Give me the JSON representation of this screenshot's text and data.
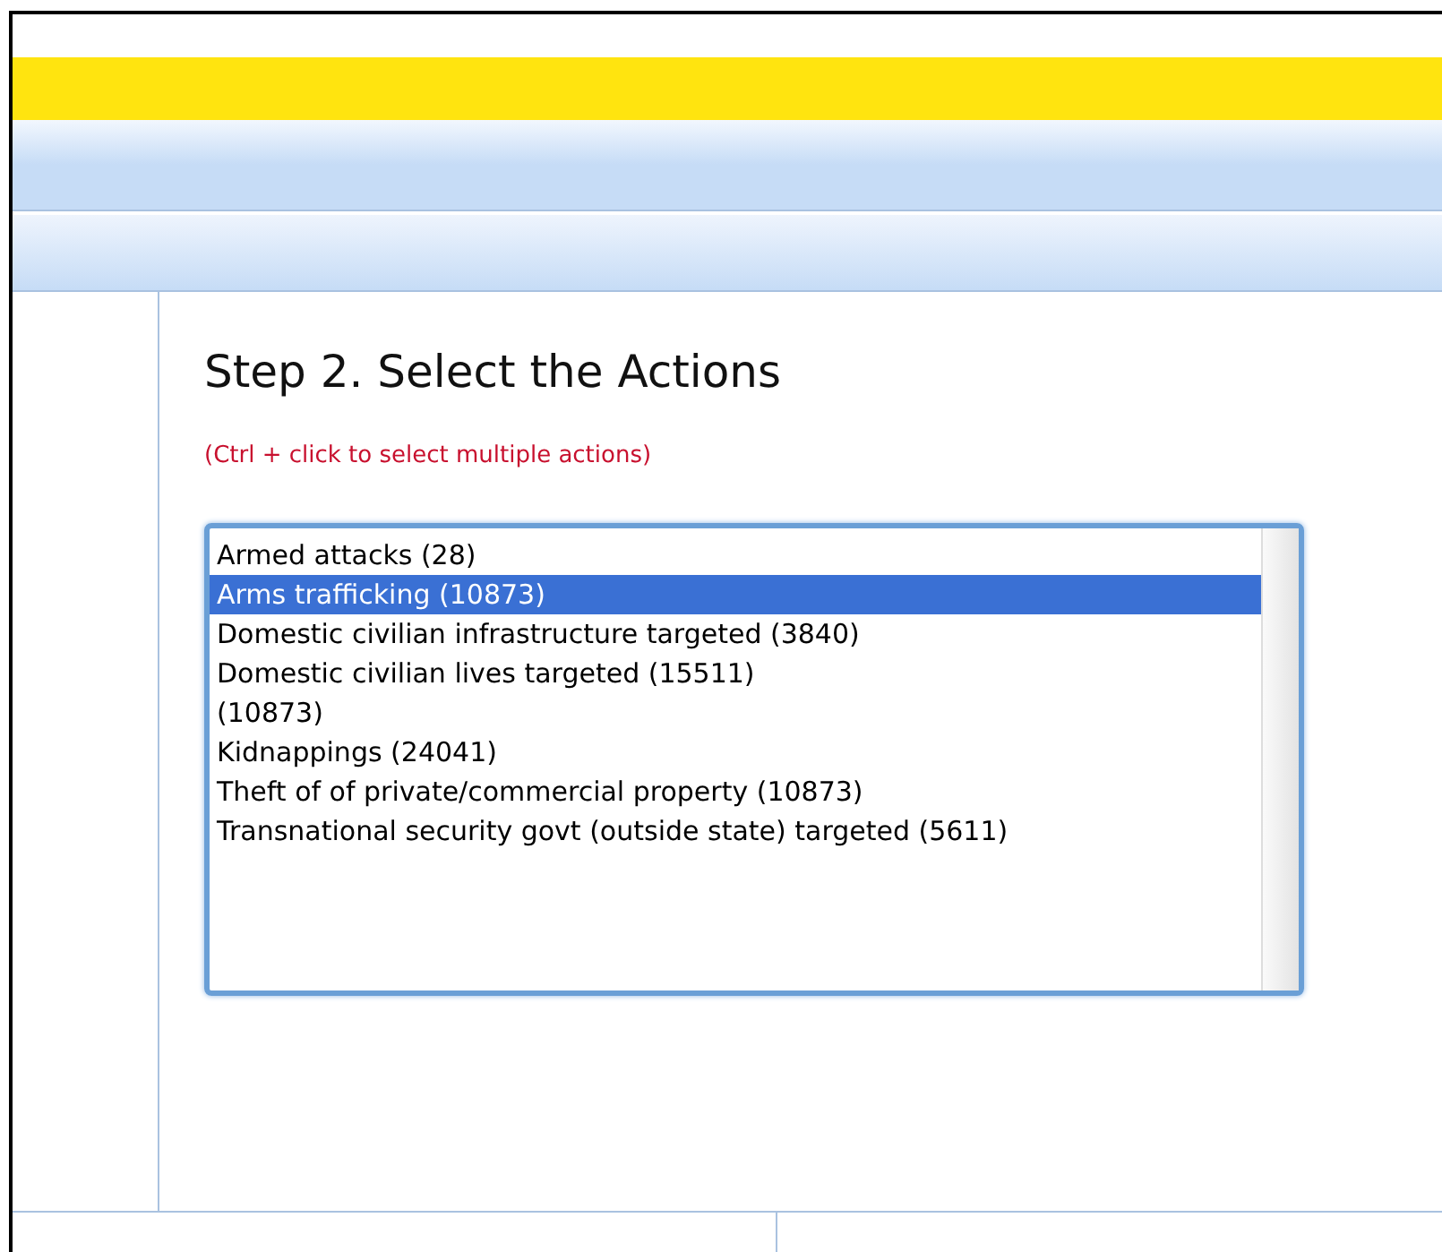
{
  "heading": "Step 2. Select the Actions",
  "hint": "(Ctrl + click to select multiple actions)",
  "actions": [
    {
      "label": "Armed attacks (28)",
      "selected": false
    },
    {
      "label": "Arms trafficking (10873)",
      "selected": true
    },
    {
      "label": "Domestic civilian infrastructure targeted (3840)",
      "selected": false
    },
    {
      "label": "Domestic civilian lives targeted (15511)",
      "selected": false
    },
    {
      "label": "(10873)",
      "selected": false
    },
    {
      "label": "Kidnappings (24041)",
      "selected": false
    },
    {
      "label": "Theft of of private/commercial property (10873)",
      "selected": false
    },
    {
      "label": "Transnational security govt (outside state) targeted (5611)",
      "selected": false
    }
  ]
}
